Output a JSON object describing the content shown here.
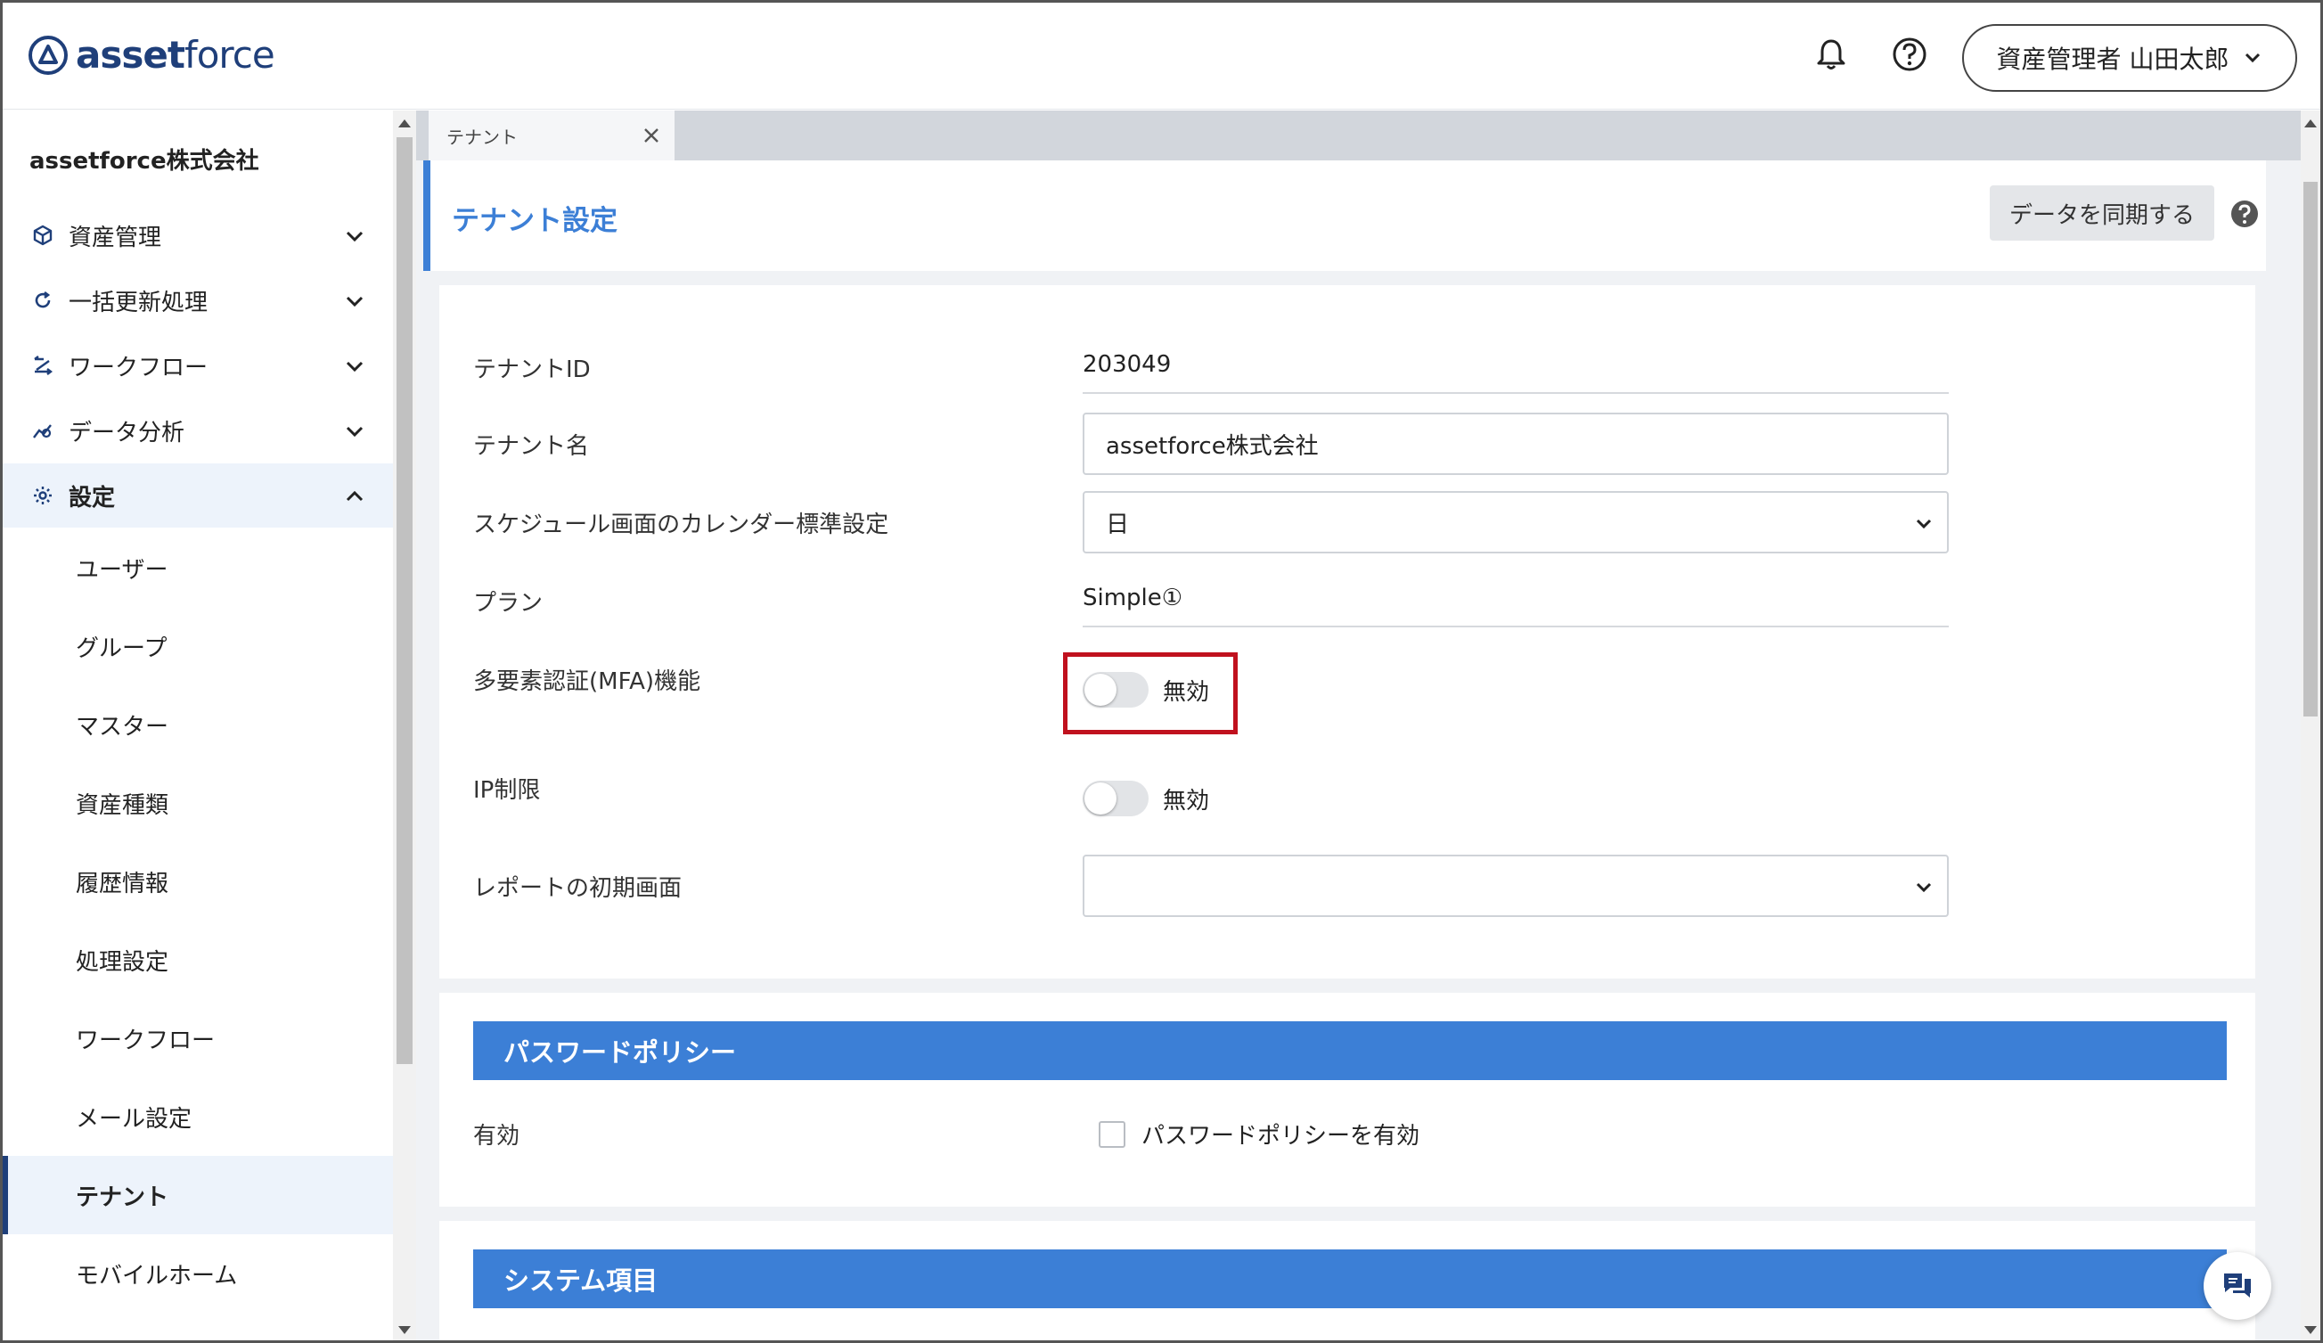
{
  "app": {
    "logo_text_bold": "asset",
    "logo_text_light": "force"
  },
  "header": {
    "user_label": "資産管理者 山田太郎"
  },
  "sidebar": {
    "company": "assetforce株式会社",
    "groups": [
      {
        "label": "資産管理",
        "icon": "cube-icon"
      },
      {
        "label": "一括更新処理",
        "icon": "refresh-icon"
      },
      {
        "label": "ワークフロー",
        "icon": "workflow-icon"
      },
      {
        "label": "データ分析",
        "icon": "analytics-icon"
      },
      {
        "label": "設定",
        "icon": "gear-icon"
      }
    ],
    "settings_items": [
      "ユーザー",
      "グループ",
      "マスター",
      "資産種類",
      "履歴情報",
      "処理設定",
      "ワークフロー",
      "メール設定",
      "テナント",
      "モバイルホーム"
    ],
    "current_item": "テナント"
  },
  "tabs": [
    {
      "label": "テナント"
    }
  ],
  "page": {
    "title": "テナント設定",
    "sync_button": "データを同期する"
  },
  "form": {
    "tenant_id": {
      "label": "テナントID",
      "value": "203049"
    },
    "tenant_name": {
      "label": "テナント名",
      "value": "assetforce株式会社"
    },
    "calendar_default": {
      "label": "スケジュール画面のカレンダー標準設定",
      "value": "日"
    },
    "plan": {
      "label": "プラン",
      "value": "Simple①"
    },
    "mfa": {
      "label": "多要素認証(MFA)機能",
      "state": "無効"
    },
    "ip_restriction": {
      "label": "IP制限",
      "state": "無効"
    },
    "report_initial": {
      "label": "レポートの初期画面",
      "value": ""
    }
  },
  "password_policy": {
    "title": "パスワードポリシー",
    "label": "有効",
    "checkbox_label": "パスワードポリシーを有効"
  },
  "system_items": {
    "title": "システム項目"
  },
  "colors": {
    "accent": "#3c7fd6",
    "brand": "#1f3f7a",
    "highlight": "#c0111e"
  }
}
